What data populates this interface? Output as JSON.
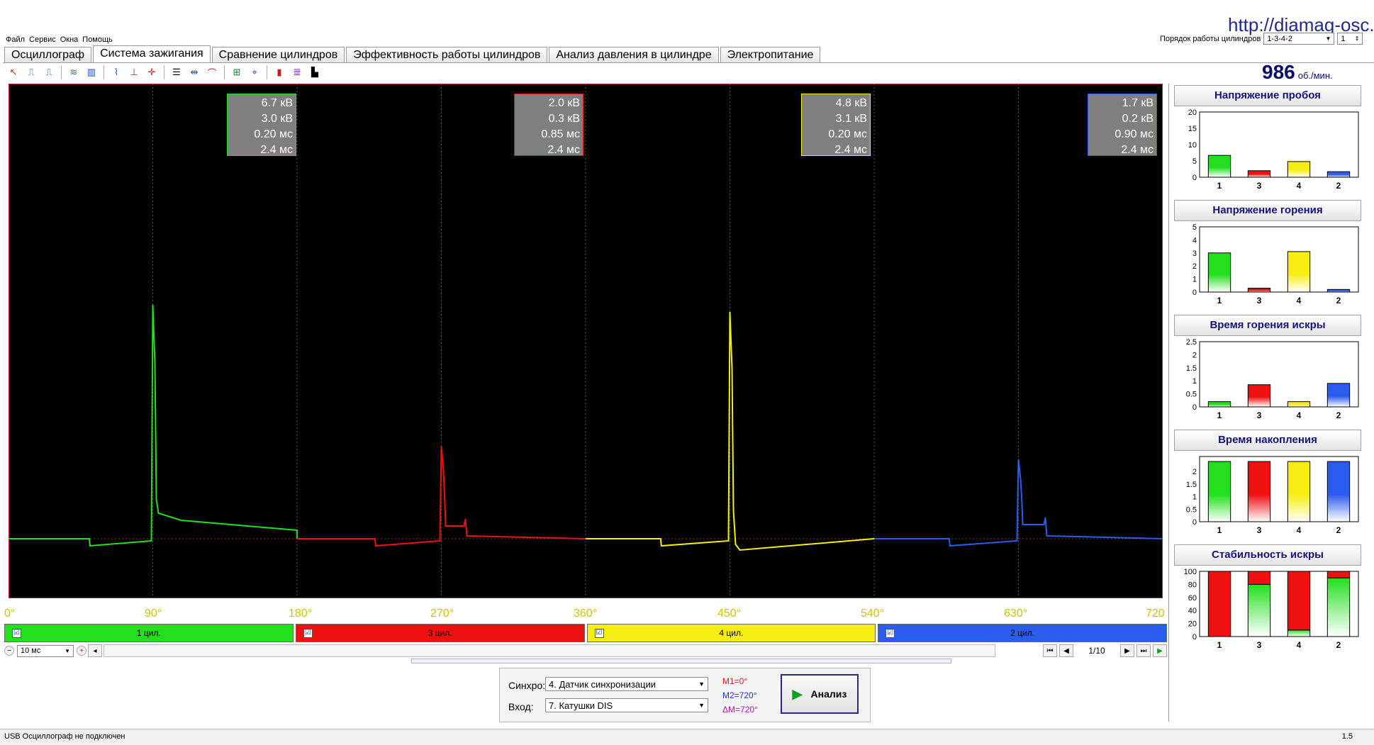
{
  "url": "http://diamag-osc.c",
  "menu": [
    "Файл",
    "Сервис",
    "Окна",
    "Помощь"
  ],
  "firing_order": {
    "label": "Порядок работы цилиндров",
    "value": "1-3-4-2",
    "index": "1"
  },
  "tabs": [
    "Осциллограф",
    "Система зажигания",
    "Сравнение цилиндров",
    "Эффективность работы цилиндров",
    "Анализ давления в цилиндре",
    "Электропитание"
  ],
  "active_tab": 1,
  "rpm": {
    "value": "986",
    "unit": "об./мин."
  },
  "colors": {
    "cyl1": "#22e01e",
    "cyl3": "#f01010",
    "cyl4": "#f5ee10",
    "cyl2": "#2b5cf0",
    "background": "#000000",
    "axis_label": "#c8c800"
  },
  "cylinder_boxes": [
    {
      "color": "cyl1",
      "lines": [
        "6.7 кВ",
        "3.0 кВ",
        "0.20 мс",
        "2.4 мс"
      ]
    },
    {
      "color": "cyl3",
      "lines": [
        "2.0 кВ",
        "0.3 кВ",
        "0.85 мс",
        "2.4 мс"
      ]
    },
    {
      "color": "cyl4",
      "lines": [
        "4.8 кВ",
        "3.1 кВ",
        "0.20 мс",
        "2.4 мс"
      ]
    },
    {
      "color": "cyl2",
      "lines": [
        "1.7 кВ",
        "0.2 кВ",
        "0.90 мс",
        "2.4 мс"
      ]
    }
  ],
  "angle_ticks": [
    "0°",
    "90°",
    "180°",
    "270°",
    "360°",
    "450°",
    "540°",
    "630°",
    "720"
  ],
  "legend": [
    {
      "label": "1 цил.",
      "color": "cyl1",
      "checked": "☑"
    },
    {
      "label": "3 цил.",
      "color": "cyl3",
      "checked": "☑"
    },
    {
      "label": "4 цил.",
      "color": "cyl4",
      "checked": "☑"
    },
    {
      "label": "2 цил.",
      "color": "cyl2",
      "checked": "☑"
    }
  ],
  "timebase": "10 мс",
  "pager": "1/10",
  "sync": {
    "label": "Синхро:",
    "value": "4. Датчик синхронизации"
  },
  "input": {
    "label": "Вход:",
    "value": "7. Катушки DIS"
  },
  "markers": {
    "m1": "M1=0°",
    "m2": "M2=720°",
    "dm": "ΔM=720°"
  },
  "analyze_label": "Анализ",
  "status": {
    "text": "USB Осциллограф не подключен",
    "version": "1.5"
  },
  "chart_data": [
    {
      "type": "bar",
      "title": "Напряжение пробоя",
      "categories": [
        "1",
        "3",
        "4",
        "2"
      ],
      "values": [
        6.7,
        2.0,
        4.8,
        1.7
      ],
      "yticks": [
        "20",
        "15",
        "10",
        "5",
        "0"
      ],
      "ylim": [
        0,
        20
      ]
    },
    {
      "type": "bar",
      "title": "Напряжение горения",
      "categories": [
        "1",
        "3",
        "4",
        "2"
      ],
      "values": [
        3.0,
        0.3,
        3.1,
        0.2
      ],
      "yticks": [
        "5",
        "4",
        "3",
        "2",
        "1",
        "0"
      ],
      "ylim": [
        0,
        5
      ]
    },
    {
      "type": "bar",
      "title": "Время горения искры",
      "categories": [
        "1",
        "3",
        "4",
        "2"
      ],
      "values": [
        0.2,
        0.85,
        0.2,
        0.9
      ],
      "yticks": [
        "2.5",
        "2",
        "1.5",
        "1",
        "0.5",
        "0"
      ],
      "ylim": [
        0,
        2.5
      ]
    },
    {
      "type": "bar",
      "title": "Время накопления",
      "categories": [
        "1",
        "3",
        "4",
        "2"
      ],
      "values": [
        2.4,
        2.4,
        2.4,
        2.4
      ],
      "yticks": [
        "2",
        "1.5",
        "1",
        "0.5",
        "0"
      ],
      "ylim": [
        0,
        2.6
      ]
    },
    {
      "type": "bar",
      "title": "Стабильность искры",
      "categories": [
        "1",
        "3",
        "4",
        "2"
      ],
      "values": [
        0,
        80,
        10,
        90
      ],
      "stacked_top": [
        100,
        20,
        90,
        10
      ],
      "yticks": [
        "100",
        "80",
        "60",
        "40",
        "20",
        "0"
      ],
      "ylim": [
        0,
        100
      ]
    }
  ]
}
